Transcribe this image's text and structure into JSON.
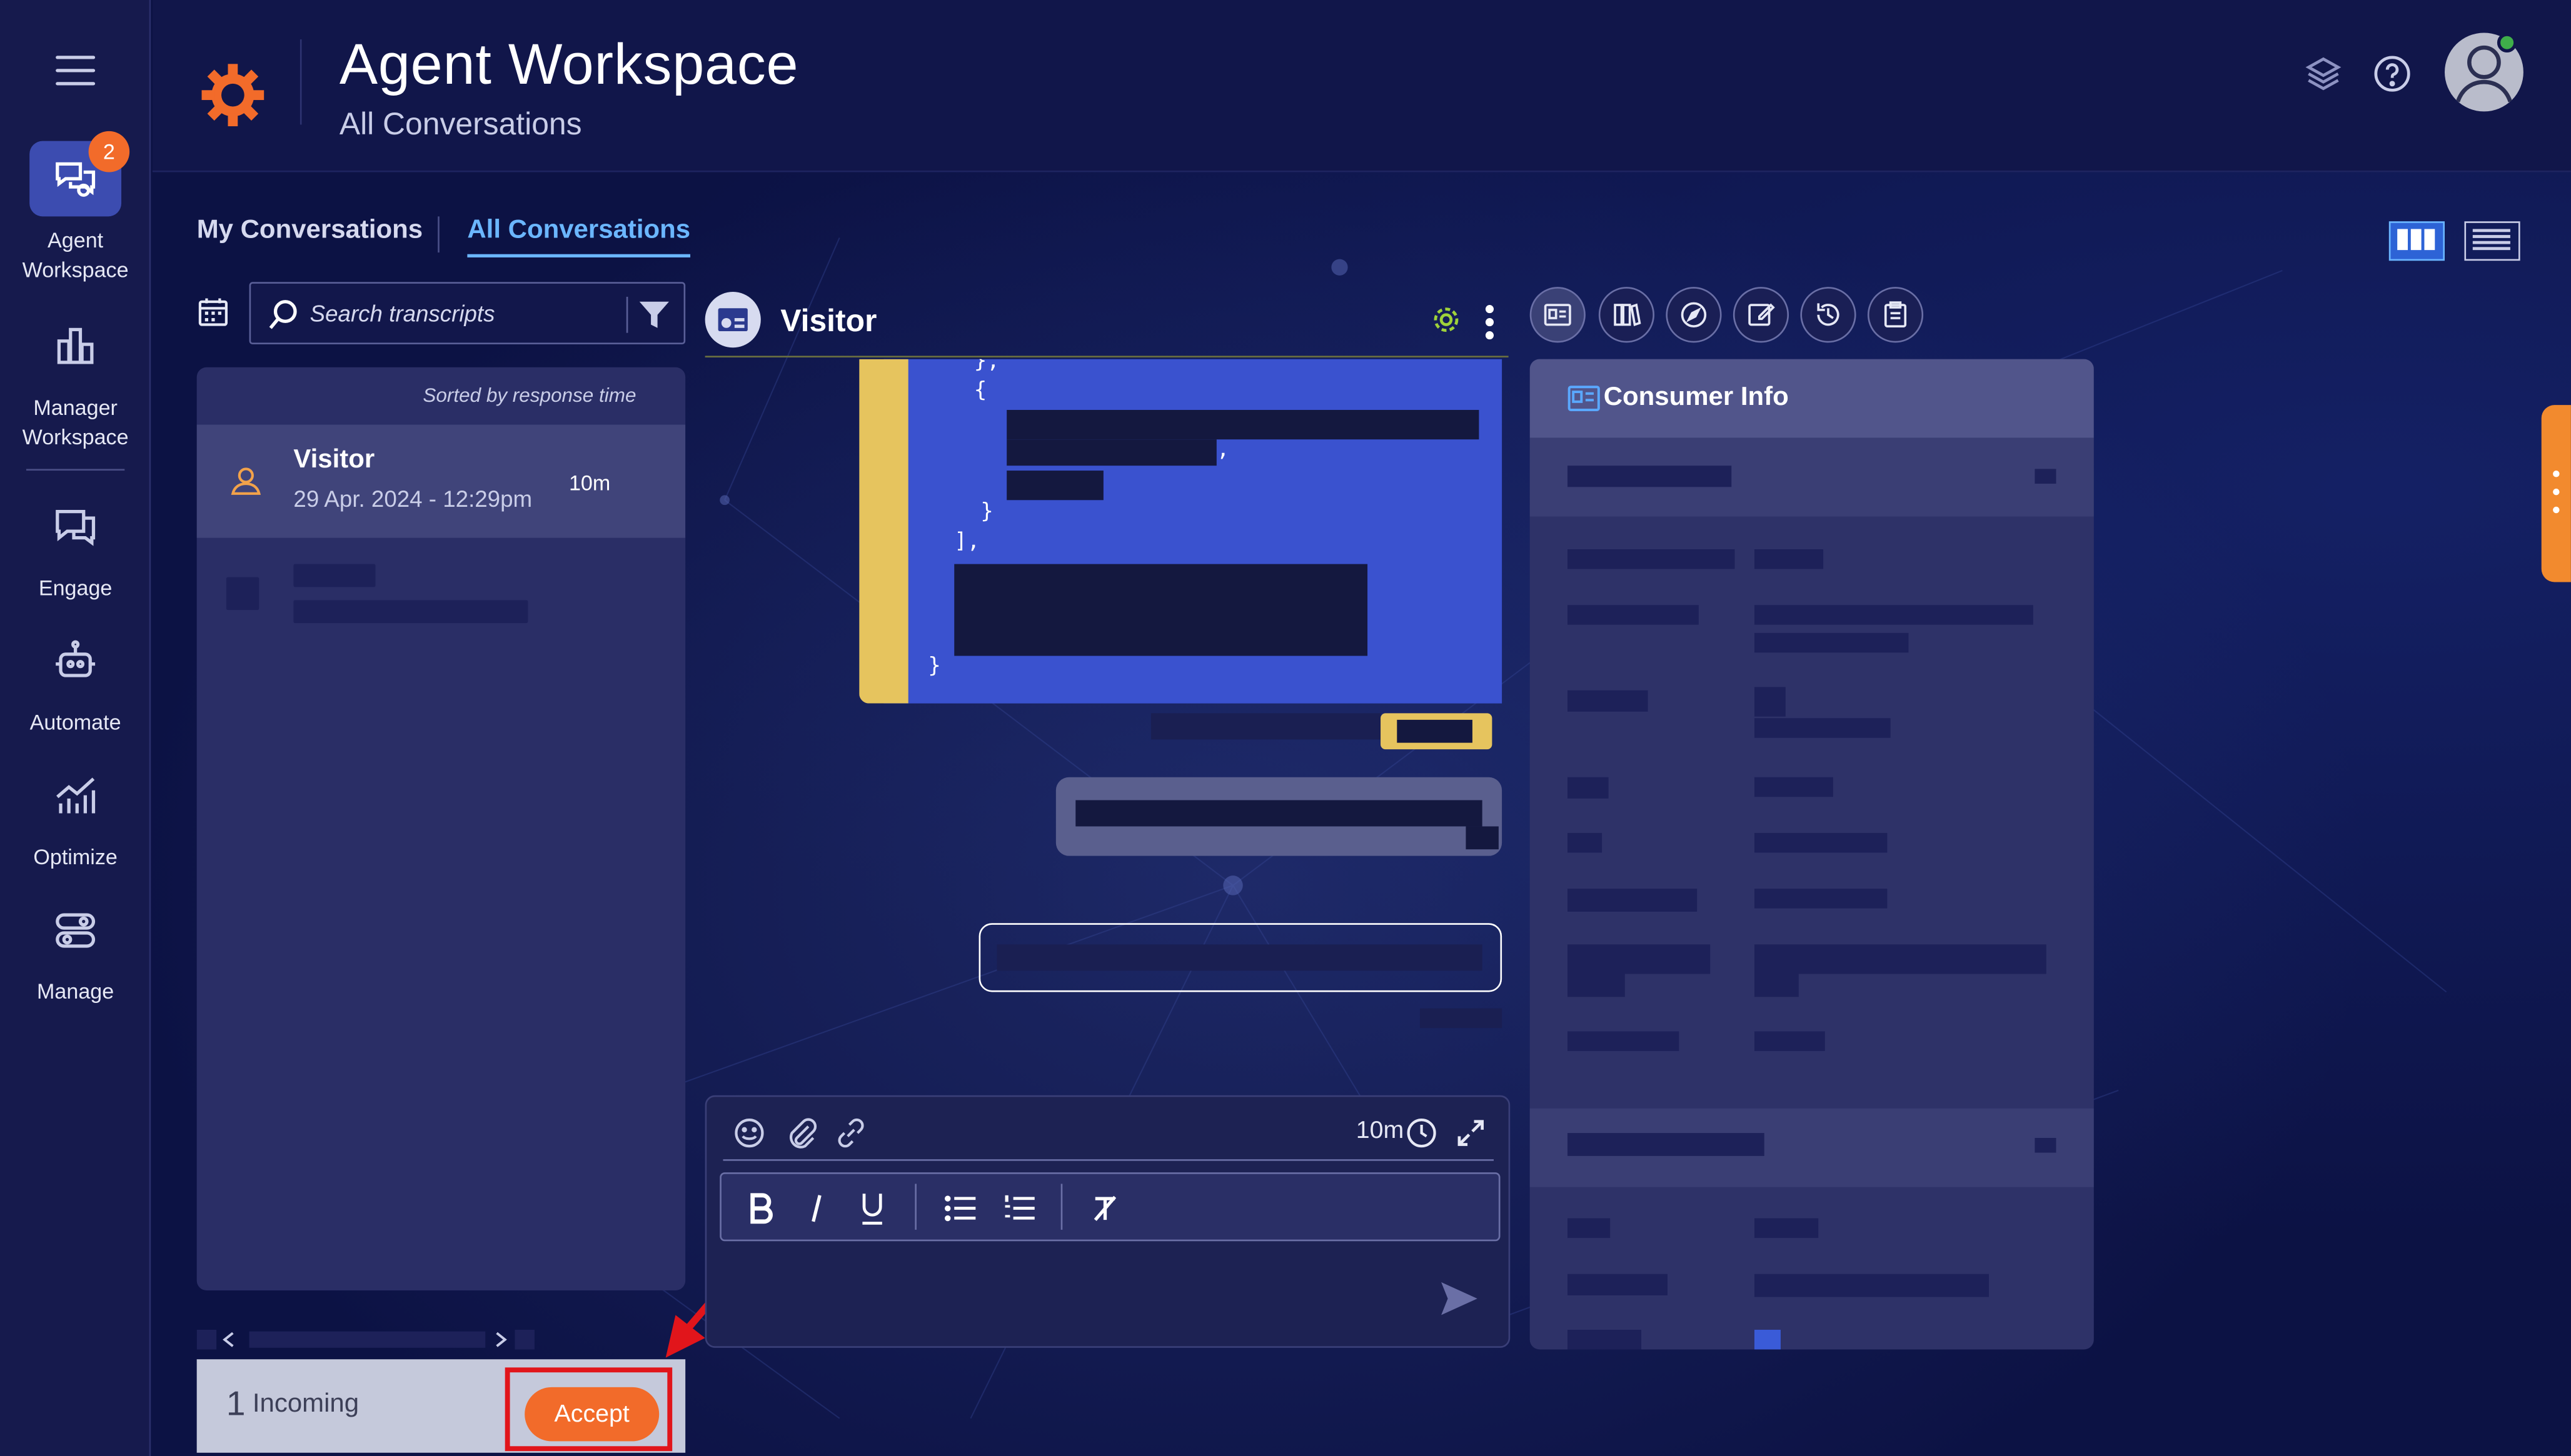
{
  "rail": {
    "badge_count": "2",
    "items": [
      {
        "label_1": "Agent",
        "label_2": "Workspace",
        "icon": "chat-bubbles-icon"
      },
      {
        "label_1": "Manager",
        "label_2": "Workspace",
        "icon": "bar-chart-icon"
      },
      {
        "label_1": "Engage",
        "icon": "chat-icon"
      },
      {
        "label_1": "Automate",
        "icon": "robot-icon"
      },
      {
        "label_1": "Optimize",
        "icon": "trend-chart-icon"
      },
      {
        "label_1": "Manage",
        "icon": "toggles-icon"
      }
    ]
  },
  "header": {
    "title": "Agent Workspace",
    "subtitle": "All Conversations"
  },
  "tabs": [
    {
      "label": "My Conversations",
      "active": false
    },
    {
      "label": "All Conversations",
      "active": true
    }
  ],
  "search": {
    "placeholder": "Search transcripts"
  },
  "list": {
    "sort_label": "Sorted by response time",
    "conversations": [
      {
        "name": "Visitor",
        "date": "29 Apr. 2024 - 12:29pm",
        "age": "10m"
      }
    ]
  },
  "incoming": {
    "count": "1",
    "label": "Incoming",
    "accept_label": "Accept"
  },
  "chat": {
    "name": "Visitor",
    "code_lines": [
      "},",
      "{",
      ",",
      "}",
      "],",
      "}"
    ]
  },
  "composer": {
    "timer": "10m"
  },
  "info": {
    "title": "Consumer Info"
  },
  "colors": {
    "accent_orange": "#f26b2a",
    "active_tab": "#6bb6ff",
    "code_bg": "#3a52cf",
    "code_bar": "#e6c45e",
    "highlight_red": "#e1151b"
  }
}
